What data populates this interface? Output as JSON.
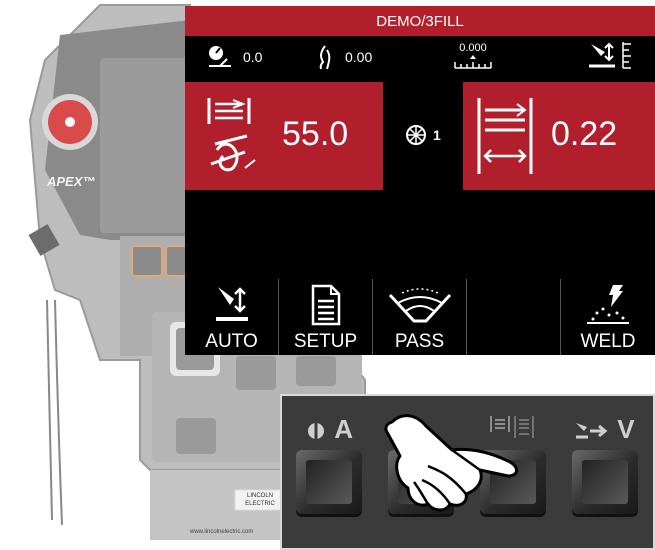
{
  "title": "DEMO/3FILL",
  "status": {
    "travel_speed": "0.0",
    "heat": "0.00",
    "position": "0.000"
  },
  "wire_feed": {
    "value": "55.0"
  },
  "pass": {
    "number": "1"
  },
  "weave": {
    "value": "0.22"
  },
  "buttons": [
    {
      "label": "AUTO"
    },
    {
      "label": "SETUP"
    },
    {
      "label": "PASS"
    },
    {
      "label": ""
    },
    {
      "label": "WELD"
    }
  ],
  "device": {
    "brand": "APEX™",
    "maker": "LINCOLN ELECTRIC",
    "website": "www.lincolnelectric.com"
  },
  "keypad": {
    "label_1": "A",
    "label_4": "V"
  },
  "colors": {
    "accent": "#b01f2b",
    "screen_bg": "#000000",
    "device_grey": "#8f8f8f"
  }
}
